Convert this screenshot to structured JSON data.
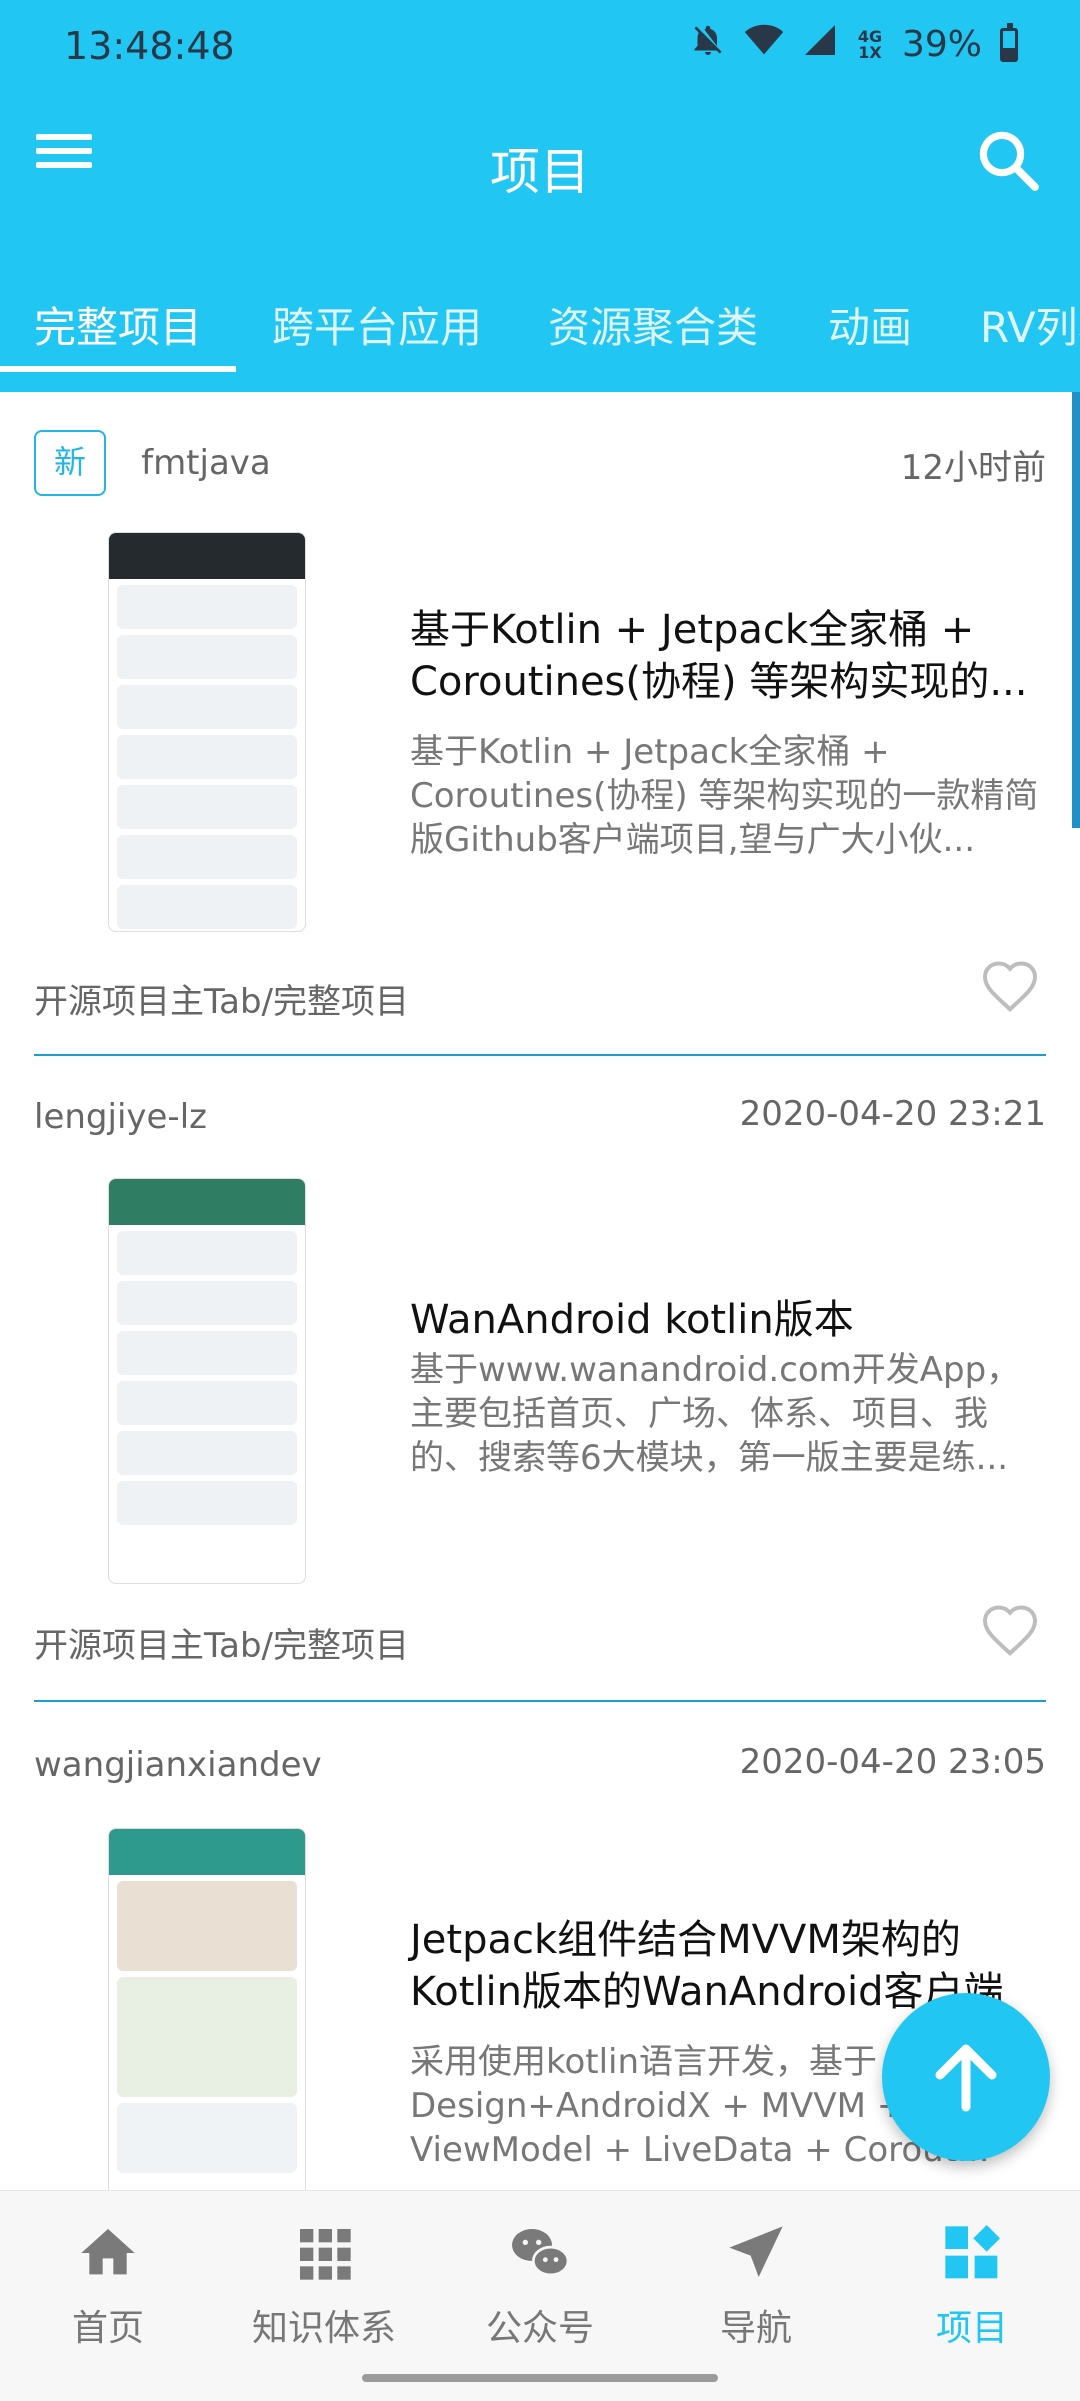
{
  "status_bar": {
    "time": "13:48:48",
    "network": "4G 1X",
    "battery_percent": "39%",
    "battery_level": 0.39
  },
  "header": {
    "title": "项目",
    "menu_icon": "hamburger-menu-icon",
    "search_icon": "search-icon"
  },
  "tabs": [
    {
      "label": "完整项目",
      "active": true
    },
    {
      "label": "跨平台应用"
    },
    {
      "label": "资源聚合类"
    },
    {
      "label": "动画"
    },
    {
      "label": "RV列表"
    }
  ],
  "items": [
    {
      "badge": "新",
      "author": "fmtjava",
      "time": "12小时前",
      "title": "基于Kotlin + Jetpack全家桶 + Coroutines(协程) 等架构实现的...",
      "desc": "基于Kotlin + Jetpack全家桶 + Coroutines(协程) 等架构实现的一款精简版Github客户端项目,望与广大小伙...",
      "chapter": "开源项目主Tab/完整项目"
    },
    {
      "author": "lengjiye-lz",
      "time": "2020-04-20 23:21",
      "title": "WanAndroid kotlin版本",
      "desc": "基于www.wanandroid.com开发App，主要包括首页、广场、体系、项目、我的、搜索等6大模块，第一版主要是练...",
      "chapter": "开源项目主Tab/完整项目"
    },
    {
      "author": "wangjianxiandev",
      "time": "2020-04-20 23:05",
      "title": "Jetpack组件结合MVVM架构的Kotlin版本的WanAndroid客户端",
      "desc": "采用使用kotlin语言开发，基于 Material Design+AndroidX + MVVM + ViewModel + LiveData + Corout..."
    }
  ],
  "bottom_nav": [
    {
      "label": "首页",
      "icon": "home-icon"
    },
    {
      "label": "知识体系",
      "icon": "grid-icon"
    },
    {
      "label": "公众号",
      "icon": "wechat-icon"
    },
    {
      "label": "导航",
      "icon": "navigation-icon"
    },
    {
      "label": "项目",
      "icon": "project-icon",
      "active": true
    }
  ],
  "colors": {
    "primary": "#21c6f2",
    "divider": "#1aa0d0",
    "text_secondary": "#777777"
  }
}
